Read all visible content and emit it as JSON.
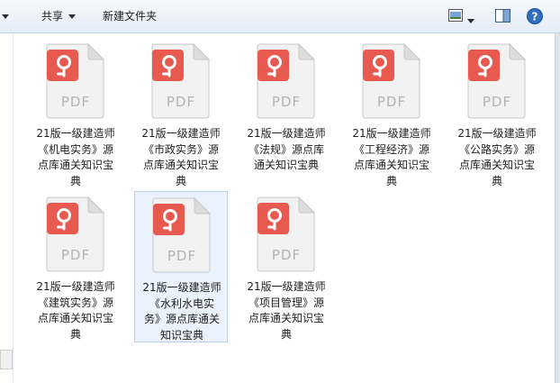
{
  "toolbar": {
    "share_label": "共享",
    "new_folder_label": "新建文件夹"
  },
  "colors": {
    "pdf_accent": "#e8594f",
    "toolbar_text": "#1e1e1e",
    "selection_bg": "#eaf3fd"
  },
  "file_icon": {
    "badge_text": "PDF",
    "icon": "pdf-document-icon"
  },
  "files": [
    {
      "name": "21版一级建造师《机电实务》源点库通关知识宝典",
      "lines": [
        "21版一级建造师",
        "《机电实务》源",
        "点库通关知识宝",
        "典"
      ]
    },
    {
      "name": "21版一级建造师《市政实务》源点库通关知识宝典",
      "lines": [
        "21版一级建造师",
        "《市政实务》源",
        "点库通关知识宝",
        "典"
      ]
    },
    {
      "name": "21版一级建造师《法规》源点库通关知识宝典",
      "lines": [
        "21版一级建造师",
        "《法规》源点库",
        "通关知识宝典"
      ]
    },
    {
      "name": "21版一级建造师《工程经济》源点库通关知识宝典",
      "lines": [
        "21版一级建造师",
        "《工程经济》源",
        "点库通关知识宝",
        "典"
      ]
    },
    {
      "name": "21版一级建造师《公路实务》源点库通关知识宝典",
      "lines": [
        "21版一级建造师",
        "《公路实务》源",
        "点库通关知识宝",
        "典"
      ]
    },
    {
      "name": "21版一级建造师《建筑实务》源点库通关知识宝典",
      "lines": [
        "21版一级建造师",
        "《建筑实务》源",
        "点库通关知识宝",
        "典"
      ]
    },
    {
      "name": "21版一级建造师《水利水电实务》源点库通关知识宝典",
      "lines": [
        "21版一级建造师",
        "《水利水电实",
        "务》源点库通关",
        "知识宝典"
      ]
    },
    {
      "name": "21版一级建造师《项目管理》源点库通关知识宝典",
      "lines": [
        "21版一级建造师",
        "《项目管理》源",
        "点库通关知识宝",
        "典"
      ]
    }
  ]
}
